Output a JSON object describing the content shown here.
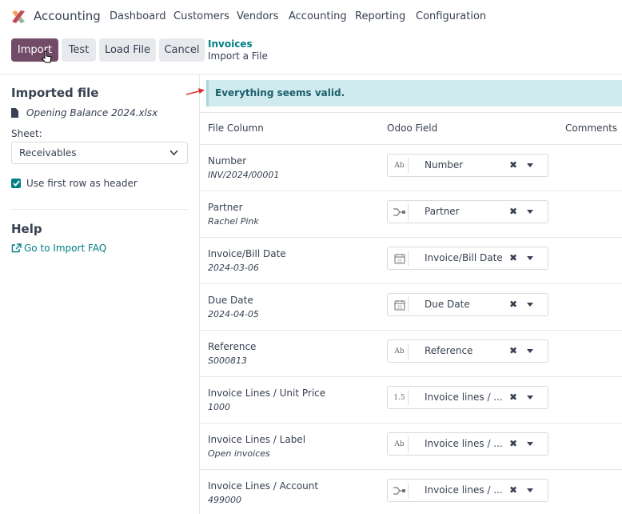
{
  "app": {
    "name": "Accounting"
  },
  "menu": [
    "Dashboard",
    "Customers",
    "Vendors",
    "Accounting",
    "Reporting",
    "Configuration"
  ],
  "controls": {
    "import": "Import",
    "test": "Test",
    "load_file": "Load File",
    "cancel": "Cancel"
  },
  "breadcrumb": {
    "parent": "Invoices",
    "current": "Import a File"
  },
  "sidebar": {
    "title": "Imported file",
    "file_name": "Opening Balance 2024.xlsx",
    "sheet_label": "Sheet:",
    "sheet_value": "Receivables",
    "checkbox_label": "Use first row as header",
    "help_title": "Help",
    "help_link": "Go to Import FAQ"
  },
  "alert": "Everything seems valid.",
  "table": {
    "headers": {
      "file_column": "File Column",
      "odoo_field": "Odoo Field",
      "comments": "Comments"
    },
    "rows": [
      {
        "column": "Number",
        "sample": "INV/2024/00001",
        "icon": "text-icon",
        "icon_text": "Ab",
        "field": "Number"
      },
      {
        "column": "Partner",
        "sample": "Rachel Pink",
        "icon": "relation-icon",
        "icon_text": "",
        "field": "Partner"
      },
      {
        "column": "Invoice/Bill Date",
        "sample": "2024-03-06",
        "icon": "calendar-icon",
        "icon_text": "",
        "field": "Invoice/Bill Date"
      },
      {
        "column": "Due Date",
        "sample": "2024-04-05",
        "icon": "calendar-icon",
        "icon_text": "",
        "field": "Due Date"
      },
      {
        "column": "Reference",
        "sample": "S000813",
        "icon": "text-icon",
        "icon_text": "Ab",
        "field": "Reference"
      },
      {
        "column": "Invoice Lines / Unit Price",
        "sample": "1000",
        "icon": "float-icon",
        "icon_text": "1.5",
        "field": "Invoice lines / ..."
      },
      {
        "column": "Invoice Lines / Label",
        "sample": "Open invoices",
        "icon": "text-icon",
        "icon_text": "Ab",
        "field": "Invoice lines / ..."
      },
      {
        "column": "Invoice Lines / Account",
        "sample": "499000",
        "icon": "relation-icon",
        "icon_text": "",
        "field": "Invoice lines / ..."
      }
    ]
  },
  "colors": {
    "primary": "#714b67",
    "teal": "#017e84",
    "alert_bg": "#d0ebef"
  }
}
